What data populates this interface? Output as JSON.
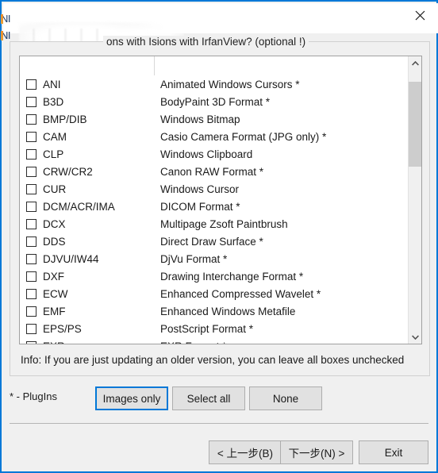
{
  "window": {
    "close_icon": "close-icon",
    "accent_color": "#0078d7",
    "face_color": "#f0f0f0"
  },
  "ghost_fragments": [
    {
      "text": "NI"
    },
    {
      "text": "NI"
    }
  ],
  "groupbox": {
    "title": "ons with Isions with IrfanView? (optional !)"
  },
  "list": {
    "rows": [
      {
        "ext": "ANI",
        "desc": "Animated Windows Cursors *",
        "checked": false
      },
      {
        "ext": "B3D",
        "desc": "BodyPaint 3D Format *",
        "checked": false
      },
      {
        "ext": "BMP/DIB",
        "desc": "Windows Bitmap",
        "checked": false
      },
      {
        "ext": "CAM",
        "desc": "Casio Camera Format (JPG only) *",
        "checked": false
      },
      {
        "ext": "CLP",
        "desc": "Windows Clipboard",
        "checked": false
      },
      {
        "ext": "CRW/CR2",
        "desc": "Canon RAW Format *",
        "checked": false
      },
      {
        "ext": "CUR",
        "desc": "Windows Cursor",
        "checked": false
      },
      {
        "ext": "DCM/ACR/IMA",
        "desc": "DICOM Format *",
        "checked": false
      },
      {
        "ext": "DCX",
        "desc": "Multipage Zsoft Paintbrush",
        "checked": false
      },
      {
        "ext": "DDS",
        "desc": "Direct Draw Surface *",
        "checked": false
      },
      {
        "ext": "DJVU/IW44",
        "desc": "DjVu Format *",
        "checked": false
      },
      {
        "ext": "DXF",
        "desc": "Drawing Interchange Format *",
        "checked": false
      },
      {
        "ext": "ECW",
        "desc": "Enhanced Compressed Wavelet *",
        "checked": false
      },
      {
        "ext": "EMF",
        "desc": "Enhanced Windows Metafile",
        "checked": false
      },
      {
        "ext": "EPS/PS",
        "desc": "PostScript Format *",
        "checked": false
      },
      {
        "ext": "EXR",
        "desc": "EXR Format *",
        "checked": false
      }
    ],
    "scrollbar": {
      "up_icon": "chevron-up-icon",
      "down_icon": "chevron-down-icon",
      "thumb_top_pct": 4.7,
      "thumb_height_pct": 20.2
    }
  },
  "info": {
    "text": "Info: If you are just updating an older version, you can leave all boxes unchecked"
  },
  "footer": {
    "plugins_legend": "* - PlugIns",
    "images_only_label": "Images only",
    "select_all_label": "Select all",
    "none_label": "None"
  },
  "nav": {
    "back_label": "< 上一步(B)",
    "next_label": "下一步(N) >",
    "exit_label": "Exit"
  }
}
